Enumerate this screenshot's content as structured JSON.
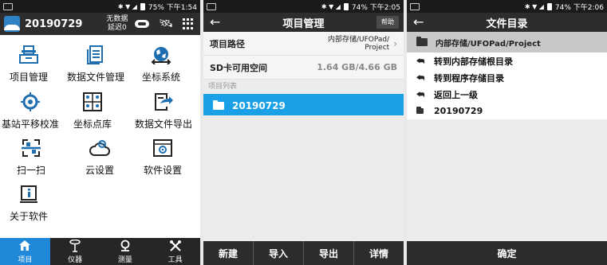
{
  "panel1": {
    "status": {
      "right": "75%  下午1:54"
    },
    "title": {
      "project": "20190729",
      "status_line1": "无数据",
      "status_line2": "延迟0"
    },
    "grid": [
      {
        "label": "项目管理",
        "icon": "project-manage-icon"
      },
      {
        "label": "数据文件管理",
        "icon": "data-file-icon"
      },
      {
        "label": "坐标系统",
        "icon": "coordinate-system-icon"
      },
      {
        "label": "基站平移校准",
        "icon": "base-calibration-icon"
      },
      {
        "label": "坐标点库",
        "icon": "point-library-icon"
      },
      {
        "label": "数据文件导出",
        "icon": "export-icon"
      },
      {
        "label": "扫一扫",
        "icon": "scan-icon"
      },
      {
        "label": "云设置",
        "icon": "cloud-settings-icon"
      },
      {
        "label": "软件设置",
        "icon": "software-settings-icon"
      },
      {
        "label": "关于软件",
        "icon": "about-icon"
      }
    ],
    "tabs": [
      {
        "label": "项目",
        "icon": "home-icon",
        "active": true
      },
      {
        "label": "仪器",
        "icon": "instrument-icon",
        "active": false
      },
      {
        "label": "测量",
        "icon": "measure-icon",
        "active": false
      },
      {
        "label": "工具",
        "icon": "tools-icon",
        "active": false
      }
    ],
    "colors": {
      "accent": "#1f88d8",
      "icon_blue": "#1f6fb0"
    }
  },
  "panel2": {
    "status": {
      "right": "74%  下午2:05"
    },
    "title": "项目管理",
    "help": "帮助",
    "path_label": "项目路径",
    "path_value_line1": "内部存储/UFOPad/",
    "path_value_line2": "Project",
    "sd_label": "SD卡可用空间",
    "sd_value": "1.64 GB/4.66 GB",
    "list_label": "项目列表",
    "list_items": [
      "20190729"
    ],
    "buttons": [
      "新建",
      "导入",
      "导出",
      "详情"
    ],
    "colors": {
      "selected": "#1aa0e6"
    }
  },
  "panel3": {
    "status": {
      "right": "74%  下午2:06"
    },
    "title": "文件目录",
    "path": "内部存储/UFOPad/Project",
    "items": [
      {
        "label": "转到内部存储根目录",
        "icon": "reply-arrow-icon"
      },
      {
        "label": "转到程序存储目录",
        "icon": "reply-arrow-icon"
      },
      {
        "label": "返回上一级",
        "icon": "reply-arrow-icon"
      },
      {
        "label": "20190729",
        "icon": "folder-icon"
      }
    ],
    "confirm": "确定"
  }
}
